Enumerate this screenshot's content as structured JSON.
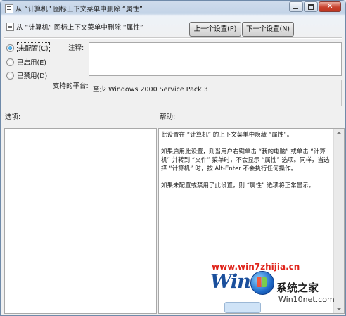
{
  "window": {
    "title": "从 “计算机” 图标上下文菜单中删除 “属性”"
  },
  "header": {
    "setting_name": "从 “计算机” 图标上下文菜单中删除 “属性”",
    "prev_button": "上一个设置(P)",
    "next_button": "下一个设置(N)"
  },
  "state": {
    "options": [
      {
        "label": "未配置(C)",
        "checked": true
      },
      {
        "label": "已启用(E)",
        "checked": false
      },
      {
        "label": "已禁用(D)",
        "checked": false
      }
    ]
  },
  "comment": {
    "label": "注释:",
    "value": ""
  },
  "platform": {
    "label": "支持的平台:",
    "value": "至少 Windows 2000 Service Pack 3"
  },
  "options_panel": {
    "label": "选项:"
  },
  "help_panel": {
    "label": "帮助:",
    "paragraphs": [
      "此设置在 “计算机” 的上下文菜单中隐藏 “属性”。",
      "如果启用此设置，则当用户右键单击 “我的电脑” 或单击 “计算机” 并转到 “文件” 菜单时，不会显示 “属性” 选项。同样，当选择 “计算机” 时，按 Alt-Enter 不会执行任何操作。",
      "如果未配置或禁用了此设置，则 “属性” 选项将正常显示。"
    ]
  },
  "watermark": {
    "url": "www.win7zhijia.cn",
    "brand_text": "Win",
    "site_name": "系统之家",
    "site_domain": "Win10net.com"
  },
  "colors": {
    "title_gradient_top": "#cfdcec",
    "close_button": "#c8432f",
    "watermark_red": "#e0241b",
    "watermark_blue": "#1a4f9c",
    "radio_dot": "#1b64b8"
  }
}
